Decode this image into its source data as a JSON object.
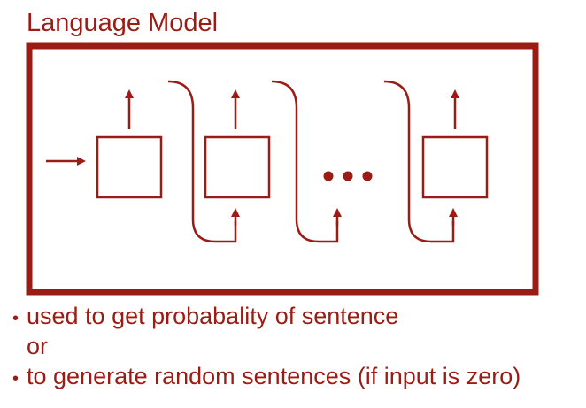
{
  "title": "Language Model",
  "bullets": {
    "first": "used to get probabality of sentence",
    "connector": "or",
    "second": "to generate random sentences (if input is zero)"
  },
  "diagram": {
    "ellipsis": "•••"
  },
  "colors": {
    "accent": "#9b1c14"
  }
}
